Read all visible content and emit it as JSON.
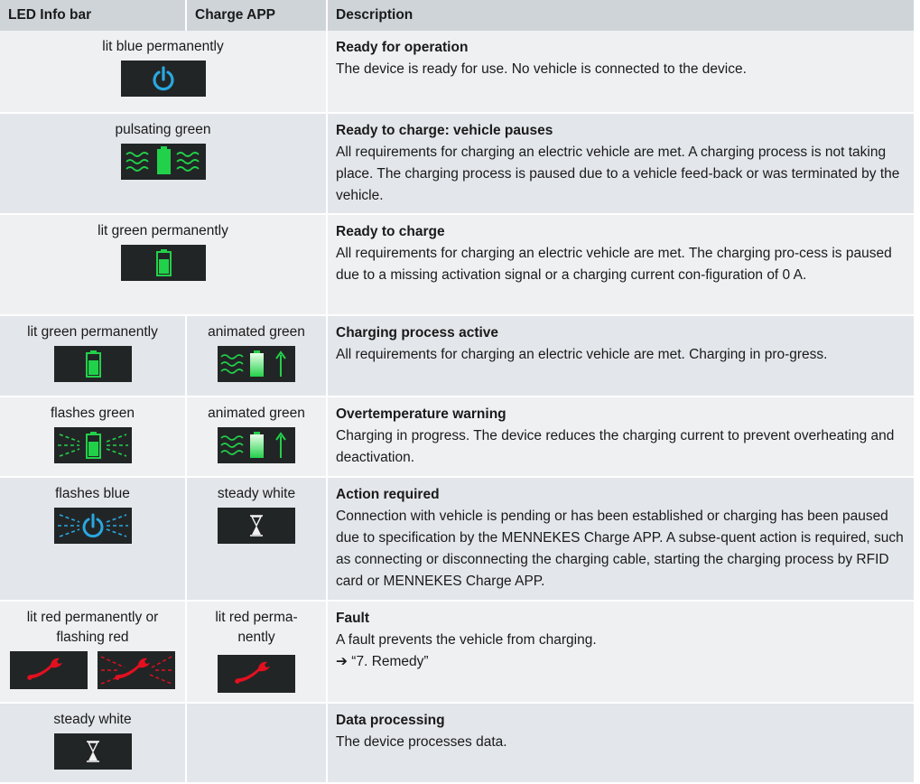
{
  "header": {
    "col_led": "LED Info bar",
    "col_app": "Charge APP",
    "col_desc": "Description"
  },
  "rows": [
    {
      "led_label": "lit blue permanently",
      "led_icon": "power-icon-blue",
      "title": "Ready for operation",
      "body": "The device is ready for use. No vehicle is connected to the device."
    },
    {
      "led_label": "pulsating green",
      "led_icon": "battery-pulsating-green-icon",
      "title": "Ready to charge: vehicle pauses",
      "body": "All requirements for charging an electric vehicle are met. A charging process is not taking place. The charging process is paused due to a vehicle feed-back or was terminated by the vehicle."
    },
    {
      "led_label": "lit green permanently",
      "led_icon": "battery-green-icon",
      "title": "Ready to charge",
      "body": "All requirements for charging an electric vehicle are met. The charging pro-cess is paused due to a missing activation signal or a charging current con-figuration of 0 A."
    },
    {
      "led_label": "lit green permanently",
      "led_icon": "battery-green-icon",
      "app_label": "animated green",
      "app_icon": "battery-charging-animated-green-icon",
      "title": "Charging process active",
      "body": "All requirements for charging an electric vehicle are met. Charging in pro-gress."
    },
    {
      "led_label": "flashes green",
      "led_icon": "battery-flashing-green-icon",
      "app_label": "animated green",
      "app_icon": "battery-charging-animated-green-icon",
      "title": "Overtemperature warning",
      "body": "Charging in progress. The device reduces the charging current to prevent overheating and deactivation."
    },
    {
      "led_label": "flashes blue",
      "led_icon": "power-flashing-blue-icon",
      "app_label": "steady white",
      "app_icon": "hourglass-icon",
      "title": "Action required",
      "body": "Connection with vehicle is pending or has been established or charging has been paused due to specification by the MENNEKES Charge APP. A subse-quent action is required, such as connecting or disconnecting the charging cable, starting the charging process by RFID card or MENNEKES Charge APP."
    },
    {
      "led_label_1": "lit red permanently or",
      "led_label_2": "flashing red",
      "led_icons": [
        "wrench-red-icon",
        "wrench-flashing-red-icon"
      ],
      "app_label_1": "lit red perma-",
      "app_label_2": "nently",
      "app_icon": "wrench-red-icon",
      "title": "Fault",
      "body": "A fault prevents the vehicle from charging.",
      "link": "➔ “7. Remedy”"
    },
    {
      "led_label": "steady white",
      "led_icon": "hourglass-icon",
      "title": "Data processing",
      "body": "The device processes data."
    }
  ],
  "colors": {
    "header_bg": "#cfd4d9",
    "row_bg_light": "#eef0f2",
    "row_bg_dark": "#e3e6ea",
    "icon_bg": "#222526",
    "blue": "#29a8e0",
    "green": "#22d14a",
    "red": "#e3101f",
    "white": "#f2f2f2"
  }
}
